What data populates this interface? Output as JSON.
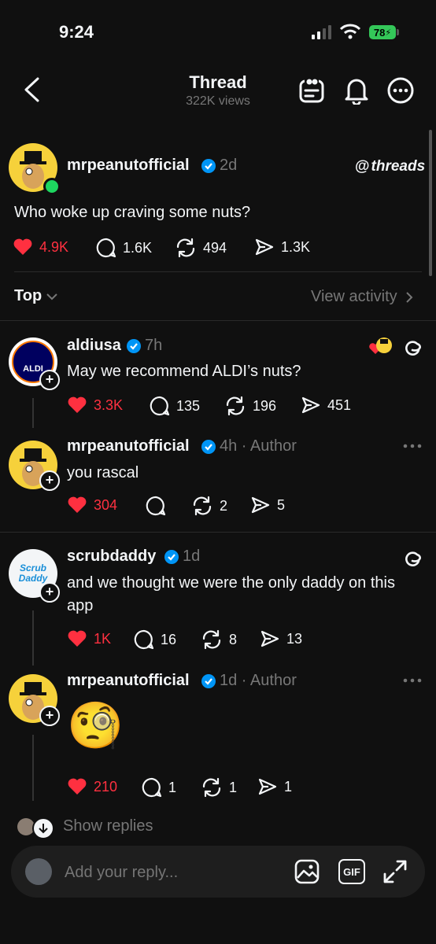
{
  "status_bar": {
    "time": "9:24",
    "battery": "78"
  },
  "header": {
    "title": "Thread",
    "views": "322K views"
  },
  "main_post": {
    "username": "mrpeanutofficial",
    "time": "2d",
    "brand": "threads",
    "text": "Who woke up craving some nuts?",
    "likes": "4.9K",
    "replies": "1.6K",
    "reposts": "494",
    "shares": "1.3K"
  },
  "sort": {
    "label": "Top",
    "view_activity": "View activity"
  },
  "replies": [
    {
      "username": "aldiusa",
      "time": "7h",
      "author": "",
      "text": "May we recommend ALDI’s nuts?",
      "likes": "3.3K",
      "replies": "135",
      "reposts": "196",
      "shares": "451",
      "avatar_text": "ALDI"
    },
    {
      "username": "mrpeanutofficial",
      "time": "4h",
      "author": "Author",
      "text": "you rascal",
      "likes": "304",
      "replies": "",
      "reposts": "2",
      "shares": "5"
    },
    {
      "username": "scrubdaddy",
      "time": "1d",
      "author": "",
      "text": "and we thought we were the only daddy on this app",
      "likes": "1K",
      "replies": "16",
      "reposts": "8",
      "shares": "13",
      "avatar_text": "Scrub Daddy"
    },
    {
      "username": "mrpeanutofficial",
      "time": "1d",
      "author": "Author",
      "text": "🧐",
      "likes": "210",
      "replies": "1",
      "reposts": "1",
      "shares": "1"
    }
  ],
  "show_replies": "Show replies",
  "reply_input": {
    "placeholder": "Add your reply...",
    "gif_label": "GIF"
  },
  "colors": {
    "background": "#101010",
    "like": "#ff3040",
    "verified": "#0095f6",
    "battery": "#34c759"
  }
}
